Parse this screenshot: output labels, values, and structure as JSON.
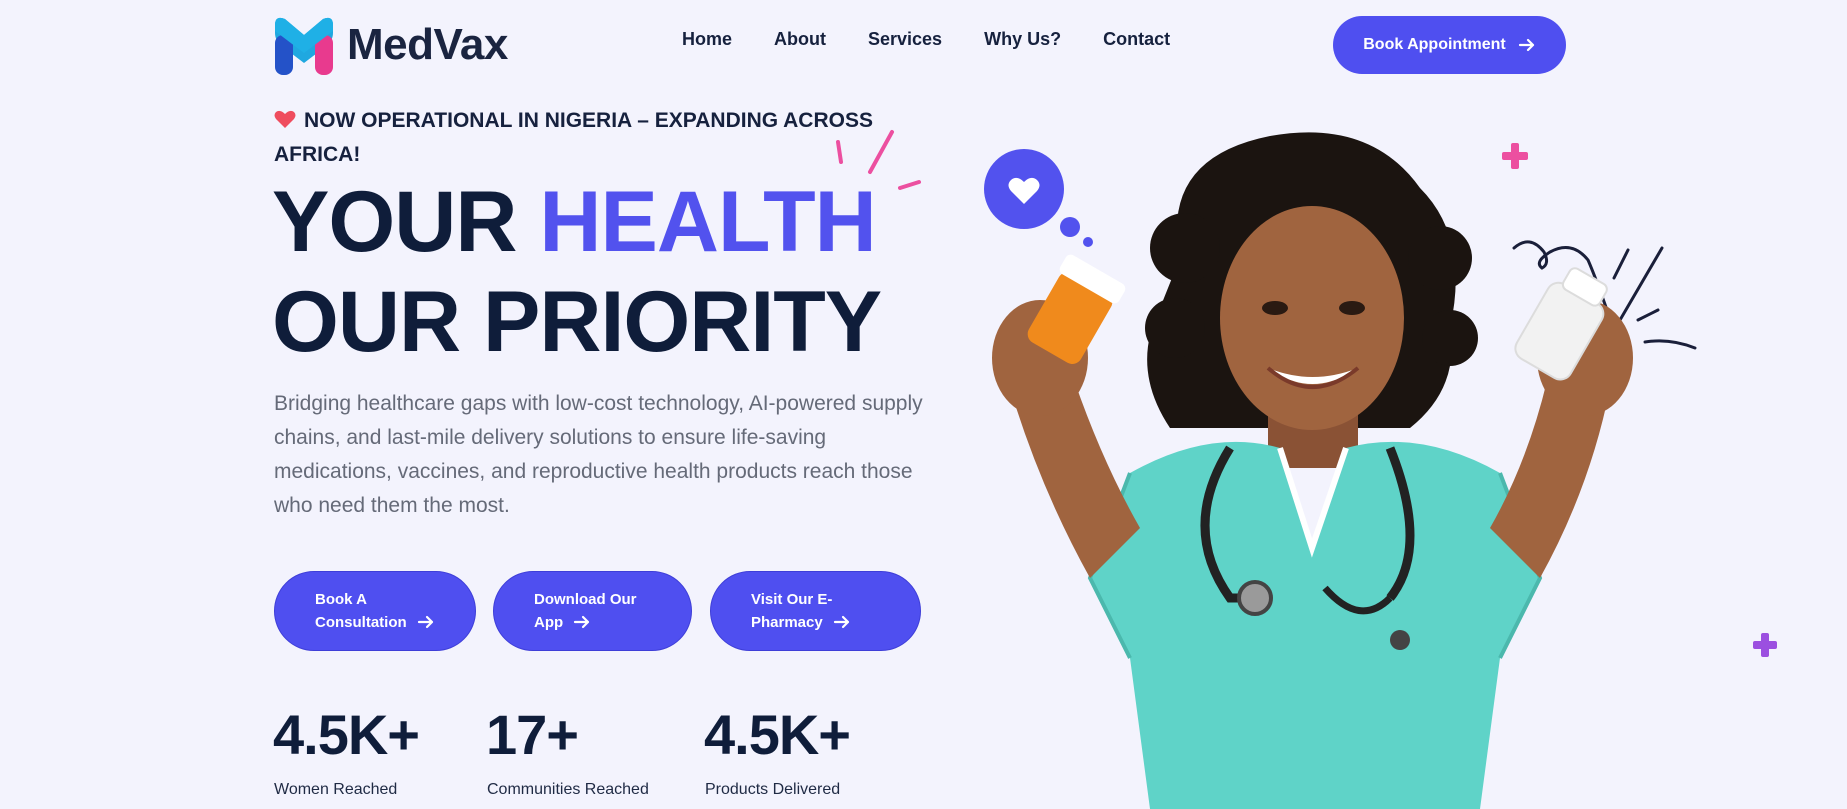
{
  "brand": {
    "name": "MedVax"
  },
  "nav": {
    "items": [
      "Home",
      "About",
      "Services",
      "Why Us?",
      "Contact"
    ]
  },
  "header": {
    "cta_label": "Book Appointment"
  },
  "hero": {
    "announcement": "NOW OPERATIONAL IN NIGERIA – EXPANDING ACROSS AFRICA!",
    "headline_part1": "YOUR",
    "headline_accent": "HEALTH",
    "headline_line2": "OUR PRIORITY",
    "subtext": "Bridging healthcare gaps with low-cost technology, AI-powered supply chains, and last-mile delivery solutions to ensure life-saving medications, vaccines, and reproductive health products reach those who need them the most.",
    "buttons": [
      {
        "line1": "Book A",
        "line2": "Consultation"
      },
      {
        "line1": "Download Our",
        "line2": "App"
      },
      {
        "line1": "Visit Our E-",
        "line2": "Pharmacy"
      }
    ]
  },
  "stats": [
    {
      "value": "4.5K+",
      "label": "Women Reached"
    },
    {
      "value": "17+",
      "label": "Communities Reached"
    },
    {
      "value": "4.5K+",
      "label": "Products Delivered"
    }
  ],
  "icons": [
    "heart-icon",
    "arrow-right-icon",
    "plus-icon",
    "logo-mark-icon"
  ],
  "colors": {
    "accent": "#4f4ff0",
    "headline_accent": "#5252ee",
    "heart": "#ef4c5e",
    "pink_plus": "#ec4fa0",
    "purple_plus": "#9b4fe0",
    "scrubs": "#5fd3c8",
    "background": "#f3f3fd"
  }
}
